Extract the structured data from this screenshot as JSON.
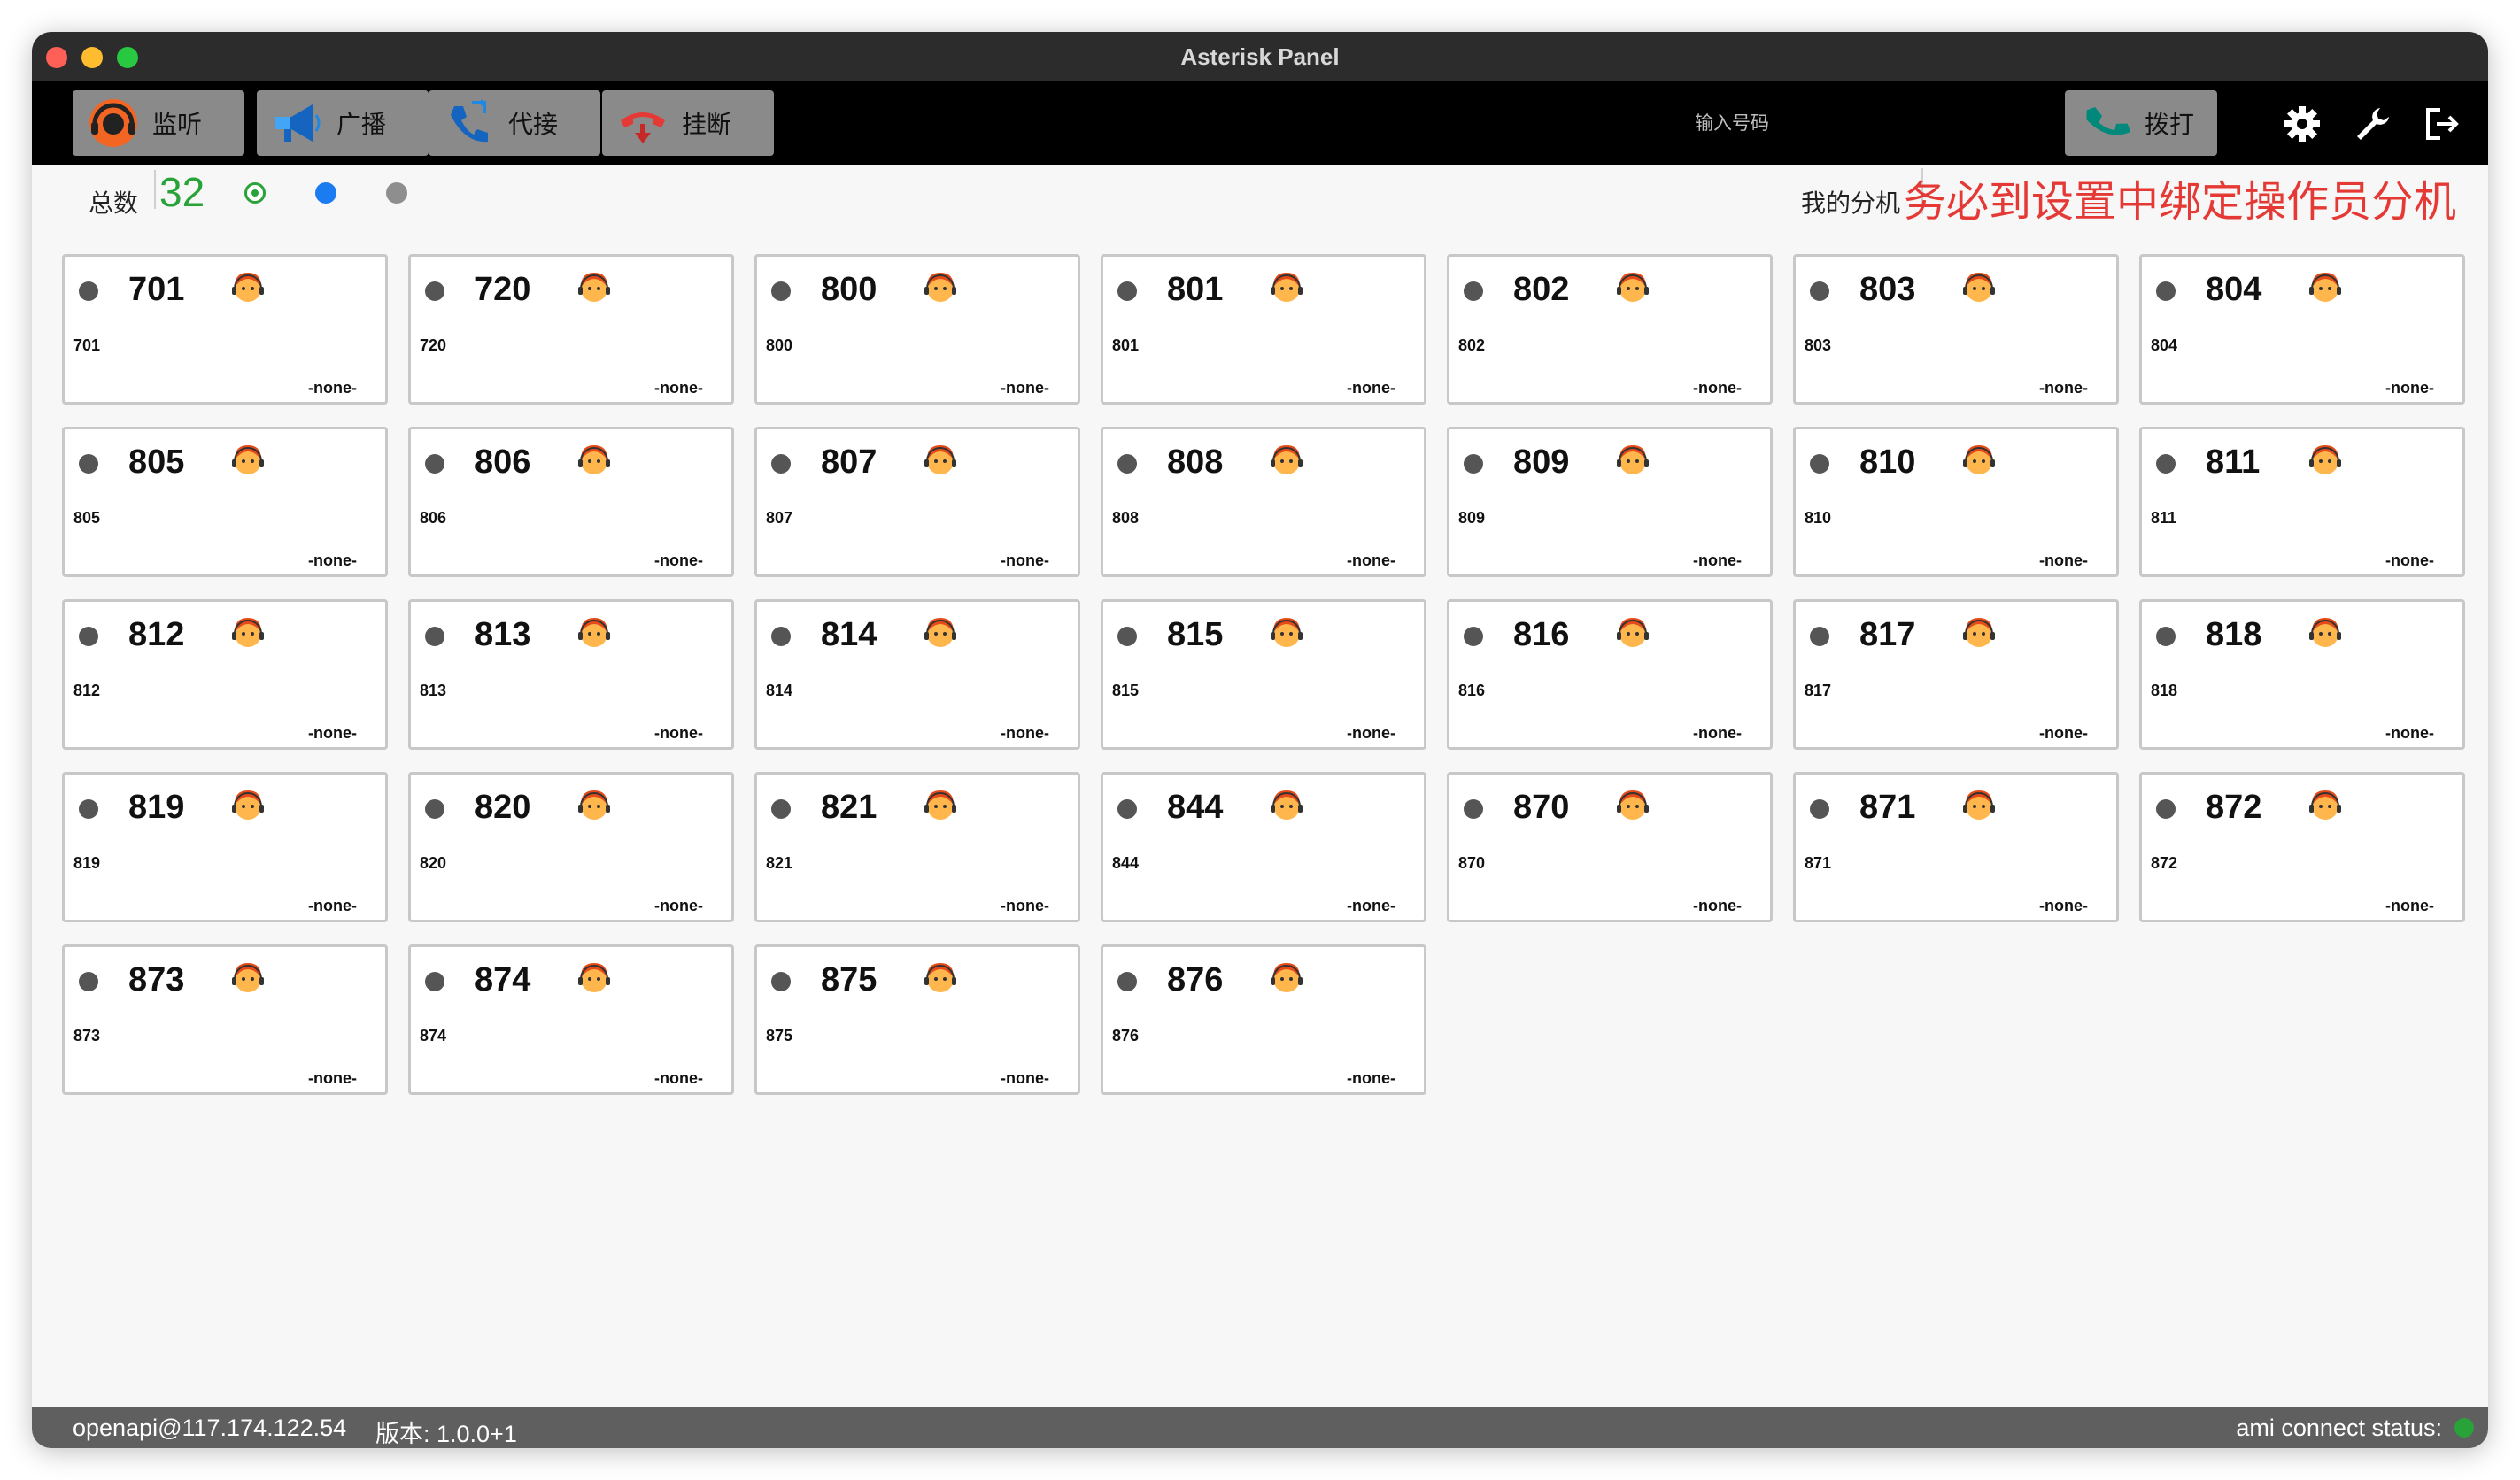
{
  "window": {
    "title": "Asterisk Panel"
  },
  "toolbar": {
    "buttons": [
      {
        "label": "监听",
        "icon": "headset-listen-icon"
      },
      {
        "label": "广播",
        "icon": "megaphone-icon"
      },
      {
        "label": "代接",
        "icon": "call-transfer-icon"
      },
      {
        "label": "挂断",
        "icon": "hangup-icon"
      }
    ],
    "dial_placeholder": "输入号码",
    "dial_label": "拨打",
    "dial_icon": "phone-dial-icon",
    "tools": [
      "gear-icon",
      "wrench-icon",
      "logout-icon"
    ]
  },
  "status": {
    "total_label": "总数",
    "total_count": "32",
    "my_extension_label": "我的分机",
    "warning": "务必到设置中绑定操作员分机",
    "colors": {
      "available": "#2aa23a",
      "busy": "#1a7cf0",
      "offline": "#8e8e8e",
      "warning": "#e53935"
    }
  },
  "extensions": [
    {
      "number": "701",
      "name": "701",
      "state": "-none-"
    },
    {
      "number": "720",
      "name": "720",
      "state": "-none-"
    },
    {
      "number": "800",
      "name": "800",
      "state": "-none-"
    },
    {
      "number": "801",
      "name": "801",
      "state": "-none-"
    },
    {
      "number": "802",
      "name": "802",
      "state": "-none-"
    },
    {
      "number": "803",
      "name": "803",
      "state": "-none-"
    },
    {
      "number": "804",
      "name": "804",
      "state": "-none-"
    },
    {
      "number": "805",
      "name": "805",
      "state": "-none-"
    },
    {
      "number": "806",
      "name": "806",
      "state": "-none-"
    },
    {
      "number": "807",
      "name": "807",
      "state": "-none-"
    },
    {
      "number": "808",
      "name": "808",
      "state": "-none-"
    },
    {
      "number": "809",
      "name": "809",
      "state": "-none-"
    },
    {
      "number": "810",
      "name": "810",
      "state": "-none-"
    },
    {
      "number": "811",
      "name": "811",
      "state": "-none-"
    },
    {
      "number": "812",
      "name": "812",
      "state": "-none-"
    },
    {
      "number": "813",
      "name": "813",
      "state": "-none-"
    },
    {
      "number": "814",
      "name": "814",
      "state": "-none-"
    },
    {
      "number": "815",
      "name": "815",
      "state": "-none-"
    },
    {
      "number": "816",
      "name": "816",
      "state": "-none-"
    },
    {
      "number": "817",
      "name": "817",
      "state": "-none-"
    },
    {
      "number": "818",
      "name": "818",
      "state": "-none-"
    },
    {
      "number": "819",
      "name": "819",
      "state": "-none-"
    },
    {
      "number": "820",
      "name": "820",
      "state": "-none-"
    },
    {
      "number": "821",
      "name": "821",
      "state": "-none-"
    },
    {
      "number": "844",
      "name": "844",
      "state": "-none-"
    },
    {
      "number": "870",
      "name": "870",
      "state": "-none-"
    },
    {
      "number": "871",
      "name": "871",
      "state": "-none-"
    },
    {
      "number": "872",
      "name": "872",
      "state": "-none-"
    },
    {
      "number": "873",
      "name": "873",
      "state": "-none-"
    },
    {
      "number": "874",
      "name": "874",
      "state": "-none-"
    },
    {
      "number": "875",
      "name": "875",
      "state": "-none-"
    },
    {
      "number": "876",
      "name": "876",
      "state": "-none-"
    }
  ],
  "footer": {
    "connection": "openapi@117.174.122.54",
    "version": "版本: 1.0.0+1",
    "ami_status_label": "ami connect status:",
    "ami_status_color": "#2aa23a"
  }
}
